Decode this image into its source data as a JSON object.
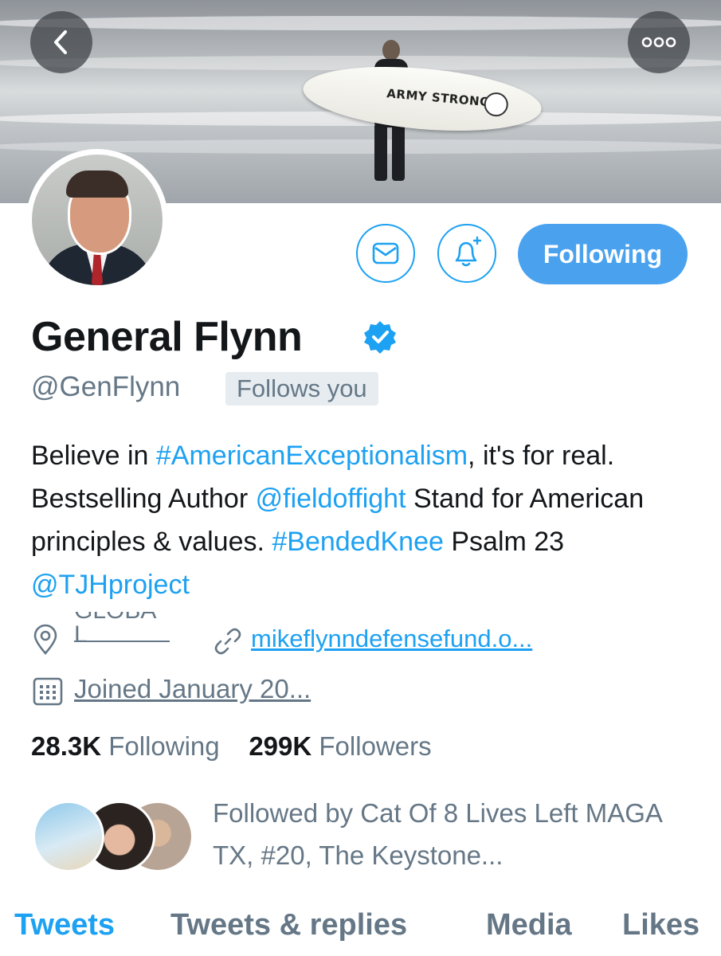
{
  "banner": {
    "board_text": "ARMY STRONG"
  },
  "actions": {
    "following_label": "Following"
  },
  "profile": {
    "name": "General Flynn",
    "handle": "@GenFlynn",
    "follows_you": "Follows you",
    "bio": [
      {
        "text": "Believe in ",
        "link": false
      },
      {
        "text": "#AmericanExceptionalism",
        "link": true
      },
      {
        "text": ", it's for real. Bestselling Author ",
        "link": false
      },
      {
        "text": "@fieldoffight",
        "link": true
      },
      {
        "text": " Stand for American principles & values. ",
        "link": false
      },
      {
        "text": "#BendedKnee",
        "link": true
      },
      {
        "text": " Psalm 23 ",
        "link": false
      },
      {
        "text": "@TJHproject",
        "link": true
      }
    ],
    "location": "GLOBA\nL",
    "website": "mikeflynndefensefund.o...",
    "joined": "Joined January 20..."
  },
  "stats": {
    "following_count": "28.3K",
    "following_label": "Following",
    "followers_count": "299K",
    "followers_label": "Followers"
  },
  "followed_by": {
    "text": "Followed by Cat Of 8 Lives Left MAGA TX, #20, The Keystone..."
  },
  "tabs": [
    {
      "label": "Tweets",
      "active": true
    },
    {
      "label": "Tweets & replies",
      "active": false
    },
    {
      "label": "Media",
      "active": false
    },
    {
      "label": "Likes",
      "active": false
    }
  ],
  "colors": {
    "accent": "#1da1f2",
    "button_fill": "#4aa2ef",
    "secondary_text": "#657786",
    "primary_text": "#14171a"
  },
  "icons": [
    "back-arrow-icon",
    "more-options-icon",
    "mail-icon",
    "bell-plus-icon",
    "verified-badge-icon",
    "location-pin-icon",
    "link-icon",
    "calendar-icon"
  ]
}
